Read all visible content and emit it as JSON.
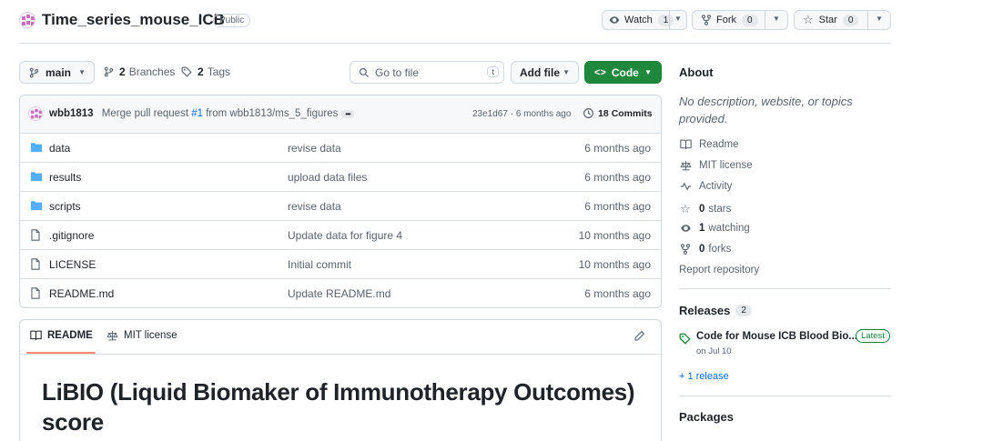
{
  "repo": {
    "name": "Time_series_mouse_ICB",
    "visibility": "Public",
    "watch_label": "Watch",
    "watch_count": "1",
    "fork_label": "Fork",
    "fork_count": "0",
    "star_label": "Star",
    "star_count": "0"
  },
  "toolbar": {
    "branch": "main",
    "branches_count": "2",
    "branches_label": "Branches",
    "tags_count": "2",
    "tags_label": "Tags",
    "search_placeholder": "Go to file",
    "search_shortcut": "t",
    "add_file_label": "Add file",
    "code_label": "Code"
  },
  "commit": {
    "author": "wbb1813",
    "message_prefix": "Merge pull request",
    "pr_link": "#1",
    "message_suffix": "from wbb1813/ms_5_figures",
    "hash": "23e1d67",
    "time": "· 6 months ago",
    "commits_count": "18",
    "commits_label": "Commits"
  },
  "files": [
    {
      "name": "data",
      "type": "folder",
      "message": "revise data",
      "time": "6 months ago"
    },
    {
      "name": "results",
      "type": "folder",
      "message": "upload data files",
      "time": "6 months ago"
    },
    {
      "name": "scripts",
      "type": "folder",
      "message": "revise data",
      "time": "6 months ago"
    },
    {
      "name": ".gitignore",
      "type": "file",
      "message": "Update data for figure 4",
      "time": "10 months ago"
    },
    {
      "name": "LICENSE",
      "type": "file",
      "message": "Initial commit",
      "time": "10 months ago"
    },
    {
      "name": "README.md",
      "type": "file",
      "message": "Update README.md",
      "time": "6 months ago"
    }
  ],
  "readme": {
    "tab_readme": "README",
    "tab_license": "MIT license",
    "heading_line1": "LiBIO (Liquid Biomaker of Immunotherapy Outcomes)",
    "heading_line2": "score"
  },
  "about": {
    "title": "About",
    "description": "No description, website, or topics provided.",
    "readme": "Readme",
    "license": "MIT license",
    "activity": "Activity",
    "stars_count": "0",
    "stars_label": "stars",
    "watching_count": "1",
    "watching_label": "watching",
    "forks_count": "0",
    "forks_label": "forks",
    "report": "Report repository"
  },
  "releases": {
    "title": "Releases",
    "count": "2",
    "latest_name": "Code for Mouse ICB Blood Bio...",
    "latest_badge": "Latest",
    "latest_date": "on Jul 10",
    "more": "+ 1 release"
  },
  "packages": {
    "title": "Packages"
  },
  "colors": {
    "accent_blue": "#0969da",
    "green_button": "#1f883d",
    "folder_blue": "#54aeff",
    "latest_green": "#1a7f37"
  }
}
